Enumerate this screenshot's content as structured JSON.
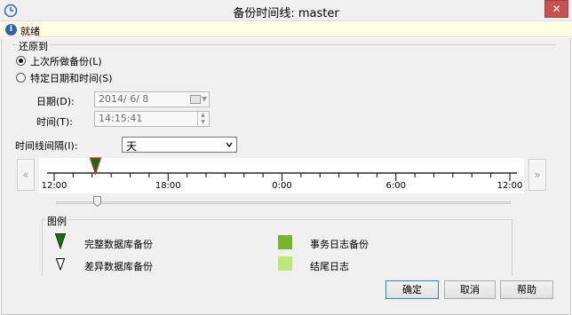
{
  "window": {
    "title": "备份时间线: master",
    "close_glyph": "✕",
    "app_icon": "clock-icon"
  },
  "status": {
    "icon": "info-icon",
    "icon_glyph": "i",
    "text": "就绪"
  },
  "restore": {
    "group_label": "还原到",
    "option_last_backup": {
      "label": "上次所做备份(L)",
      "checked": true
    },
    "option_specific": {
      "label": "特定日期和时间(S)",
      "checked": false
    },
    "date_label": "日期(D):",
    "date_value": "2014/ 6/ 8",
    "time_label": "时间(T):",
    "time_value": "14:15:41"
  },
  "interval": {
    "label": "时间线间隔(I):",
    "selected": "天"
  },
  "timeline": {
    "prev_label": "«",
    "next_label": "»",
    "ticks": [
      "12:00",
      "18:00",
      "0:00",
      "6:00",
      "12:00"
    ],
    "full_backup_position": 0.0906,
    "slider_position": 0.0906
  },
  "legend": {
    "group_label": "图例",
    "items": [
      {
        "label": "完整数据库备份",
        "icon": "full-backup-marker-icon",
        "color": "#1f6b14"
      },
      {
        "label": "差异数据库备份",
        "icon": "differential-backup-marker-icon",
        "color": "#ffffff"
      },
      {
        "label": "事务日志备份",
        "icon": "log-backup-swatch-icon",
        "color": "#7ab32e"
      },
      {
        "label": "结尾日志",
        "icon": "tail-log-swatch-icon",
        "color": "#bde878"
      }
    ]
  },
  "buttons": {
    "ok": "确定",
    "cancel": "取消",
    "help": "帮助"
  }
}
